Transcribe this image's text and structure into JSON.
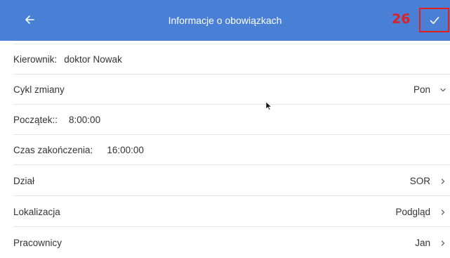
{
  "header": {
    "title": "Informacje o obowiązkach",
    "step_marker": "26",
    "back_icon": "arrow-left-icon",
    "confirm_icon": "check-icon",
    "bar_color": "#4a7fd6",
    "marker_color": "#e02020"
  },
  "rows": [
    {
      "label": "Kierownik:",
      "value": "doktor Nowak"
    },
    {
      "label": "Cykl zmiany",
      "value": "Pon",
      "icon": "chevron-down-icon"
    },
    {
      "label": "Początek::",
      "value": "8:00:00"
    },
    {
      "label": "Czas zakończenia:",
      "value": "16:00:00"
    },
    {
      "label": "Dział",
      "value": "SOR",
      "icon": "chevron-right-icon"
    },
    {
      "label": "Lokalizacja",
      "value": "Podgląd",
      "icon": "chevron-right-icon"
    },
    {
      "label": "Pracownicy",
      "value": "Jan",
      "icon": "chevron-right-icon"
    }
  ]
}
